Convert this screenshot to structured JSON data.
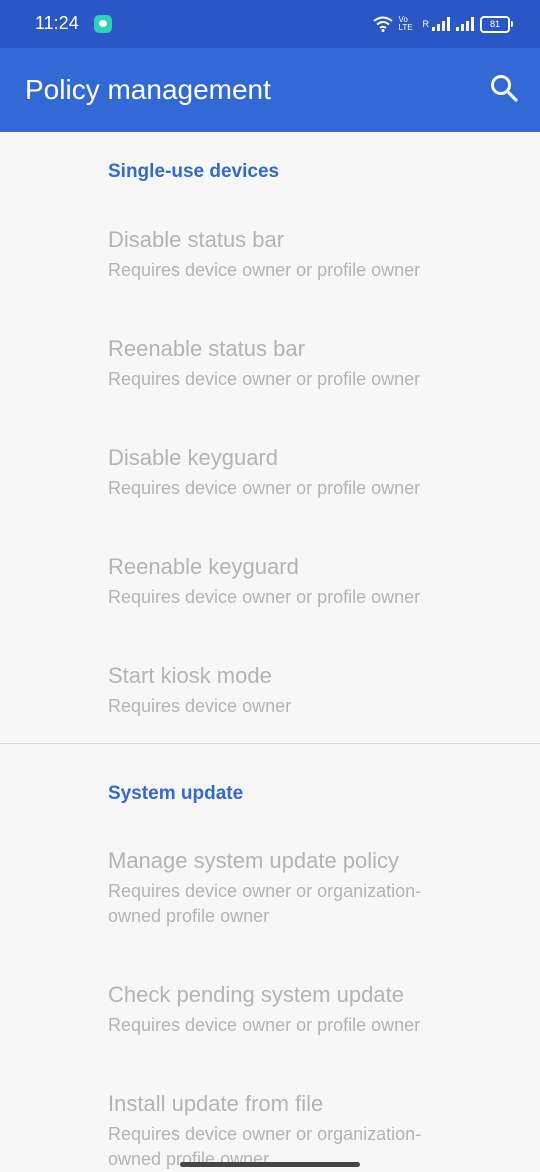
{
  "status_bar": {
    "time": "11:24",
    "volte": "Vo LTE",
    "roaming": "R",
    "battery": "81"
  },
  "app_bar": {
    "title": "Policy management"
  },
  "sections": [
    {
      "title": "Single-use devices",
      "items": [
        {
          "title": "Disable status bar",
          "summary": "Requires device owner or profile owner"
        },
        {
          "title": "Reenable status bar",
          "summary": "Requires device owner or profile owner"
        },
        {
          "title": "Disable keyguard",
          "summary": "Requires device owner or profile owner"
        },
        {
          "title": "Reenable keyguard",
          "summary": "Requires device owner or profile owner"
        },
        {
          "title": "Start kiosk mode",
          "summary": "Requires device owner"
        }
      ]
    },
    {
      "title": "System update",
      "items": [
        {
          "title": "Manage system update policy",
          "summary": "Requires device owner or organization-owned profile owner"
        },
        {
          "title": "Check pending system update",
          "summary": "Requires device owner or profile owner"
        },
        {
          "title": "Install update from file",
          "summary": "Requires device owner or organization-owned profile owner"
        }
      ]
    }
  ],
  "colors": {
    "status_bar": "#2a56c6",
    "app_bar": "#3369d6",
    "section_title": "#3369d6",
    "disabled_text": "#b3b3b3",
    "background": "#f7f7f7"
  }
}
